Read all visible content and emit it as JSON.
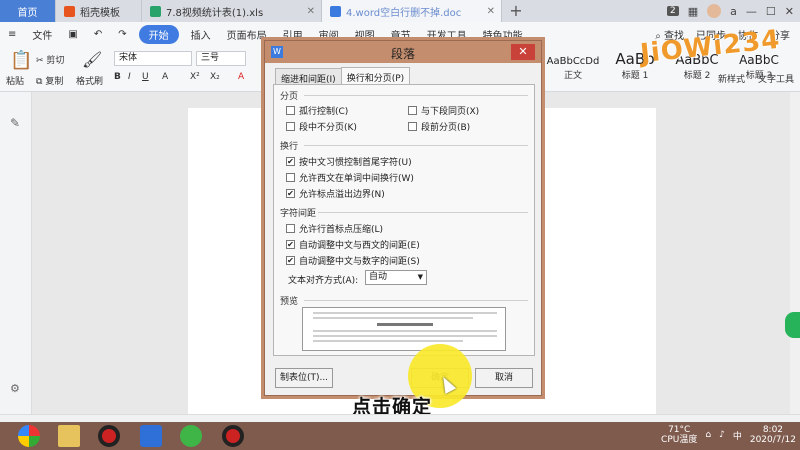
{
  "tabs": {
    "home": "首页",
    "t1": "稻壳模板",
    "t2": "7.8视频统计表(1).xls",
    "t3": "4.word空白行删不掉.doc",
    "plus": "+",
    "badge": "2",
    "user": "a"
  },
  "menu": {
    "file": "文件",
    "start": "开始",
    "items": [
      "插入",
      "页面布局",
      "引用",
      "审阅",
      "视图",
      "章节",
      "开发工具",
      "特色功能"
    ],
    "search": "查找",
    "sync": "已同步",
    "collab": "协作",
    "share": "分享"
  },
  "ribbon": {
    "paste": "粘贴",
    "cut": "剪切",
    "copy": "复制",
    "format_painter": "格式刷",
    "font": "宋体",
    "size": "三号",
    "styles": [
      {
        "preview": "AaBbCcDd",
        "label": "正文"
      },
      {
        "preview": "AaBb",
        "label": "标题 1"
      },
      {
        "preview": "AaBbC",
        "label": "标题 2"
      },
      {
        "preview": "AaBbC",
        "label": "标题 3"
      }
    ],
    "new_style": "新样式",
    "text_tool": "文字工具",
    "watermark": "JiOWi234"
  },
  "dialog": {
    "title": "段落",
    "close": "✕",
    "tab_indent": "缩进和间距(I)",
    "tab_linebreak": "换行和分页(P)",
    "group_pagination": "分页",
    "widow": "孤行控制(C)",
    "keep_next": "与下段同页(X)",
    "keep_lines": "段中不分页(K)",
    "page_break_before": "段前分页(B)",
    "group_linebreak": "换行",
    "cjk_rules": "按中文习惯控制首尾字符(U)",
    "word_wrap": "允许西文在单词中间换行(W)",
    "hanging_punct": "允许标点溢出边界(N)",
    "group_spacing": "字符间距",
    "compress_punct": "允许行首标点压缩(L)",
    "auto_space_latin": "自动调整中文与西文的间距(E)",
    "auto_space_digit": "自动调整中文与数字的间距(S)",
    "text_align_label": "文本对齐方式(A):",
    "text_align_value": "自动",
    "preview_label": "预览",
    "tabs_button": "制表位(T)...",
    "ok": "确定",
    "cancel": "取消"
  },
  "checks": {
    "widow": false,
    "keep_next": false,
    "keep_lines": false,
    "page_break_before": false,
    "cjk_rules": true,
    "word_wrap": false,
    "hanging_punct": true,
    "compress_punct": false,
    "auto_space_latin": true,
    "auto_space_digit": true
  },
  "caption": "点击确定",
  "taskbar": {
    "temp": "71°C",
    "temp_label": "CPU温度",
    "time": "8:02",
    "date": "2020/7/12",
    "lang": "中"
  }
}
